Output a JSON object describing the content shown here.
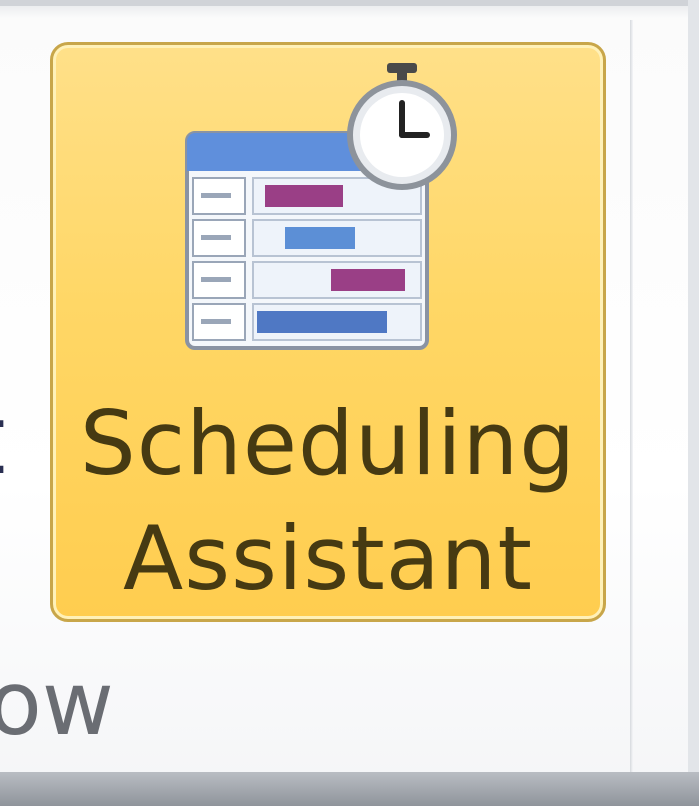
{
  "ribbon": {
    "partial_left_text": "t",
    "group_label": "ow",
    "scheduling_assistant": {
      "label_line1": "Scheduling",
      "label_line2": "Assistant",
      "icon": "scheduling-assistant-icon",
      "state": "hover"
    }
  },
  "colors": {
    "button_fill": "#ffd766",
    "button_border": "#c8a64a",
    "label_text": "#463a12"
  }
}
